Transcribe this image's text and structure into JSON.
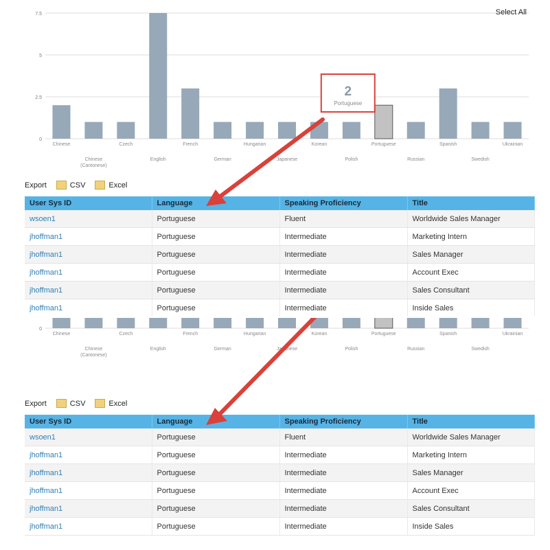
{
  "chart_data": {
    "type": "bar",
    "categories": [
      "Chinese",
      "Chinese (Cantonese)",
      "Czech",
      "English",
      "French",
      "German",
      "Hungarian",
      "Japanese",
      "Korean",
      "Polish",
      "Portuguese",
      "Russian",
      "Spanish",
      "Swedish",
      "Ukrainian"
    ],
    "values": [
      2,
      1,
      1,
      7.5,
      3,
      1,
      1,
      1,
      1,
      1,
      2,
      1,
      3,
      1,
      1
    ],
    "highlighted": "Portuguese",
    "yticks": [
      "0",
      "2.5",
      "5",
      "7.5"
    ],
    "ylim": [
      0,
      7.5
    ],
    "bar_color": "#97a8b8",
    "highlight_color": "#c2c2c2",
    "tooltip": {
      "value": "2",
      "label": "Portuguese"
    }
  },
  "select_all_label": "Select All",
  "export": {
    "label": "Export",
    "csv": "CSV",
    "excel": "Excel"
  },
  "table": {
    "columns": [
      "User Sys ID",
      "Language",
      "Speaking Proficiency",
      "Title"
    ],
    "rows": [
      [
        "wsoen1",
        "Portuguese",
        "Fluent",
        "Worldwide Sales Manager"
      ],
      [
        "jhoffman1",
        "Portuguese",
        "Intermediate",
        "Marketing Intern"
      ],
      [
        "jhoffman1",
        "Portuguese",
        "Intermediate",
        "Sales Manager"
      ],
      [
        "jhoffman1",
        "Portuguese",
        "Intermediate",
        "Account Exec"
      ],
      [
        "jhoffman1",
        "Portuguese",
        "Intermediate",
        "Sales Consultant"
      ],
      [
        "jhoffman1",
        "Portuguese",
        "Intermediate",
        "Inside Sales"
      ]
    ]
  },
  "colors": {
    "header": "#55b4e5",
    "arrow": "#d9413a",
    "link": "#2f7fb5"
  }
}
